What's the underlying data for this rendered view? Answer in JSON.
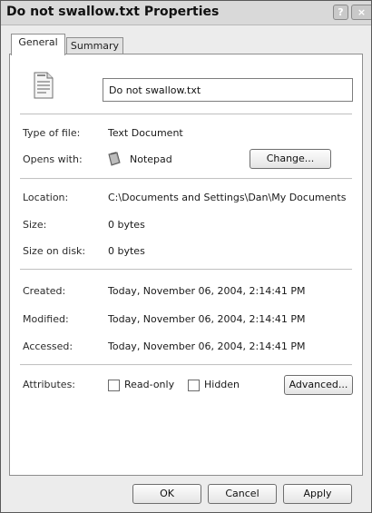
{
  "window": {
    "title": "Do not swallow.txt Properties",
    "help_button": "?",
    "close_button": "×"
  },
  "tabs": [
    {
      "label": "General",
      "active": true
    },
    {
      "label": "Summary",
      "active": false
    }
  ],
  "general": {
    "file_icon": "text-document-icon",
    "file_name": "Do not swallow.txt",
    "type_label": "Type of file:",
    "type_value": "Text Document",
    "opens_label": "Opens with:",
    "opens_icon": "notepad-icon",
    "opens_value": "Notepad",
    "change_button": "Change...",
    "location_label": "Location:",
    "location_value": "C:\\Documents and Settings\\Dan\\My Documents",
    "size_label": "Size:",
    "size_value": "0 bytes",
    "size_on_disk_label": "Size on disk:",
    "size_on_disk_value": "0 bytes",
    "created_label": "Created:",
    "created_value": "Today, November 06, 2004, 2:14:41 PM",
    "modified_label": "Modified:",
    "modified_value": "Today, November 06, 2004, 2:14:41 PM",
    "accessed_label": "Accessed:",
    "accessed_value": "Today, November 06, 2004, 2:14:41 PM",
    "attributes_label": "Attributes:",
    "readonly_label": "Read-only",
    "readonly_checked": false,
    "hidden_label": "Hidden",
    "hidden_checked": false,
    "advanced_button": "Advanced..."
  },
  "footer": {
    "ok_button": "OK",
    "cancel_button": "Cancel",
    "apply_button": "Apply"
  }
}
